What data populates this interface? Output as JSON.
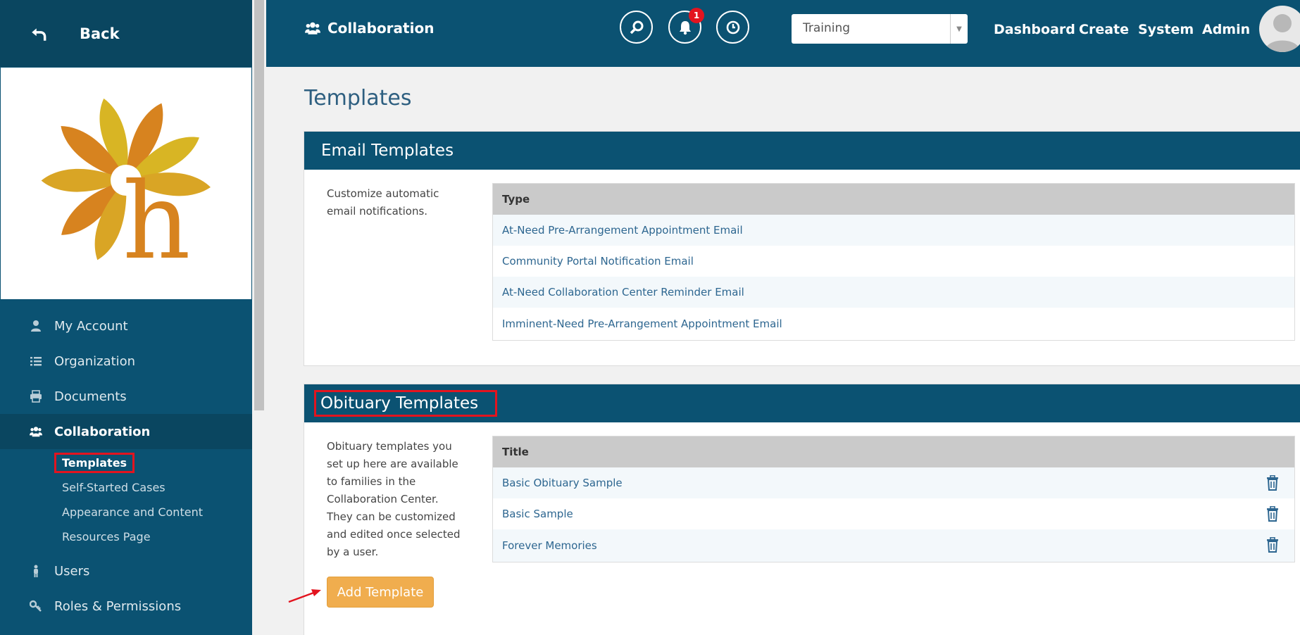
{
  "sidebar": {
    "back_label": "Back",
    "nav": [
      {
        "label": "My Account",
        "icon": "user-icon"
      },
      {
        "label": "Organization",
        "icon": "list-icon"
      },
      {
        "label": "Documents",
        "icon": "printer-icon"
      },
      {
        "label": "Collaboration",
        "icon": "users-icon",
        "active": true
      },
      {
        "label": "Users",
        "icon": "person-icon"
      },
      {
        "label": "Roles & Permissions",
        "icon": "key-icon"
      }
    ],
    "collaboration_sub": [
      "Templates",
      "Self-Started Cases",
      "Appearance and Content",
      "Resources Page"
    ]
  },
  "header": {
    "title": "Collaboration",
    "notification_count": "1",
    "organization_select": "Training",
    "links": [
      "Dashboard",
      "Create",
      "System",
      "Admin"
    ]
  },
  "main": {
    "page_title": "Templates",
    "email_panel": {
      "title": "Email Templates",
      "description": "Customize automatic email notifications.",
      "column": "Type",
      "rows": [
        "At-Need Pre-Arrangement Appointment Email",
        "Community Portal Notification Email",
        "At-Need Collaboration Center Reminder Email",
        "Imminent-Need Pre-Arrangement Appointment Email"
      ]
    },
    "obituary_panel": {
      "title": "Obituary Templates",
      "description": "Obituary templates you set up here are available to families in the Collaboration Center. They can be customized and edited once selected by a user.",
      "column": "Title",
      "rows": [
        "Basic Obituary Sample",
        "Basic Sample",
        "Forever Memories"
      ],
      "add_button": "Add Template"
    }
  },
  "colors": {
    "primary": "#0b5272",
    "accent": "#f0ad4e",
    "highlight": "#e3141f",
    "link": "#2d6690"
  }
}
